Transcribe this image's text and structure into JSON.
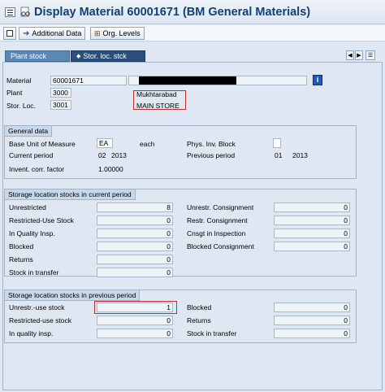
{
  "header": {
    "title": "Display Material 60001671 (BM General Materials)",
    "toolbar": {
      "additional_data": "Additional Data",
      "org_levels": "Org. Levels"
    }
  },
  "tabs": [
    {
      "label": "Plant stock",
      "active": true
    },
    {
      "label": "Stor. loc. stck",
      "active": false
    }
  ],
  "header_fields": {
    "material_label": "Material",
    "material_value": "60001671",
    "plant_label": "Plant",
    "plant_value": "3000",
    "plant_name": "Mukhtarabad",
    "storloc_label": "Stor. Loc.",
    "storloc_value": "3001",
    "storloc_name": "MAIN STORE"
  },
  "general": {
    "title": "General data",
    "base_uom_label": "Base Unit of Measure",
    "base_uom": "EA",
    "base_uom_text": "each",
    "phys_inv_label": "Phys. Inv. Block",
    "current_period_label": "Current period",
    "current_period_month": "02",
    "current_period_year": "2013",
    "previous_period_label": "Previous period",
    "previous_period_month": "01",
    "previous_period_year": "2013",
    "invent_corr_label": "Invent. corr. factor",
    "invent_corr_value": "1.00000"
  },
  "current": {
    "title": "Storage location stocks in current period",
    "left": [
      {
        "label": "Unrestricted",
        "value": "8"
      },
      {
        "label": "Restricted-Use Stock",
        "value": "0"
      },
      {
        "label": "In Quality Insp.",
        "value": "0"
      },
      {
        "label": "Blocked",
        "value": "0"
      },
      {
        "label": "Returns",
        "value": "0"
      },
      {
        "label": "Stock in transfer",
        "value": "0"
      }
    ],
    "right": [
      {
        "label": "Unrestr. Consignment",
        "value": "0"
      },
      {
        "label": "Restr. Consignment",
        "value": "0"
      },
      {
        "label": "Cnsgt in Inspection",
        "value": "0"
      },
      {
        "label": "Blocked Consignment",
        "value": "0"
      }
    ]
  },
  "previous": {
    "title": "Storage location stocks in previous period",
    "left": [
      {
        "label": "Unrestr.-use stock",
        "value": "1"
      },
      {
        "label": "Restricted-use stock",
        "value": "0"
      },
      {
        "label": "In quality insp.",
        "value": "0"
      }
    ],
    "right": [
      {
        "label": "Blocked",
        "value": "0"
      },
      {
        "label": "Returns",
        "value": "0"
      },
      {
        "label": "Stock in transfer",
        "value": "0"
      }
    ]
  },
  "colors": {
    "title": "#123f7a",
    "highlight": "#c0302a",
    "tab_active": "#5c86b3",
    "tab_inactive": "#2b4f7a"
  },
  "icons": [
    "sap-menu-icon",
    "glasses-icon",
    "arrow-right-icon",
    "org-levels-icon",
    "info-icon",
    "nav-left-icon",
    "nav-right-icon",
    "tab-list-icon"
  ]
}
